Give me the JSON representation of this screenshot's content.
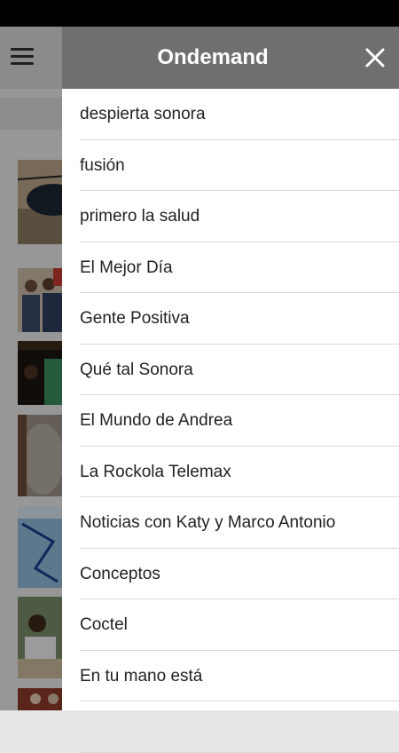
{
  "drawer": {
    "title": "Ondemand",
    "items": [
      {
        "label": "despierta sonora"
      },
      {
        "label": "fusión"
      },
      {
        "label": "primero la salud"
      },
      {
        "label": "El Mejor Día"
      },
      {
        "label": "Gente Positiva"
      },
      {
        "label": "Qué tal Sonora"
      },
      {
        "label": "El Mundo de Andrea"
      },
      {
        "label": "La Rockola Telemax"
      },
      {
        "label": "Noticias con Katy y Marco Antonio"
      },
      {
        "label": "Conceptos"
      },
      {
        "label": "Coctel"
      },
      {
        "label": "En tu mano está"
      },
      {
        "label": ""
      }
    ]
  },
  "icons": {
    "menu": "hamburger-menu-icon",
    "close": "close-icon"
  },
  "colors": {
    "drawer_header": "#6f6f6f",
    "status_bar": "#000000",
    "divider": "#d9d9d9"
  }
}
